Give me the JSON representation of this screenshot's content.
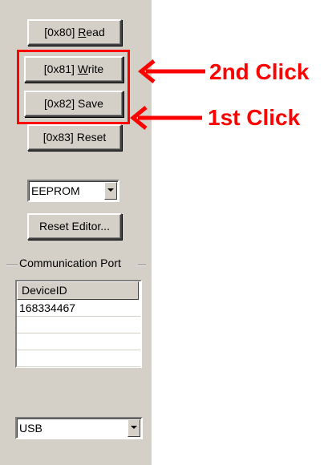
{
  "panel": {
    "buttons": {
      "read": {
        "pre": "[0x80] ",
        "accel": "R",
        "post": "ead"
      },
      "write": {
        "pre": "[0x81] ",
        "accel": "W",
        "post": "rite"
      },
      "save": {
        "pre": "[0x82] Save",
        "accel": "",
        "post": ""
      },
      "reset": {
        "pre": "[0x83] Reset",
        "accel": "",
        "post": ""
      },
      "reset_editor": "Reset Editor..."
    },
    "memory_select": {
      "value": "EEPROM"
    },
    "comm_group": {
      "label": "Communication Port",
      "device_list": {
        "header": "DeviceID",
        "rows": [
          "168334467",
          "",
          "",
          ""
        ]
      },
      "interface_select": {
        "value": "USB"
      }
    }
  },
  "annotations": {
    "highlight_color": "#ff0000",
    "second_click": "2nd Click",
    "first_click": "1st Click",
    "arrow_icon": "left-arrow-icon"
  }
}
